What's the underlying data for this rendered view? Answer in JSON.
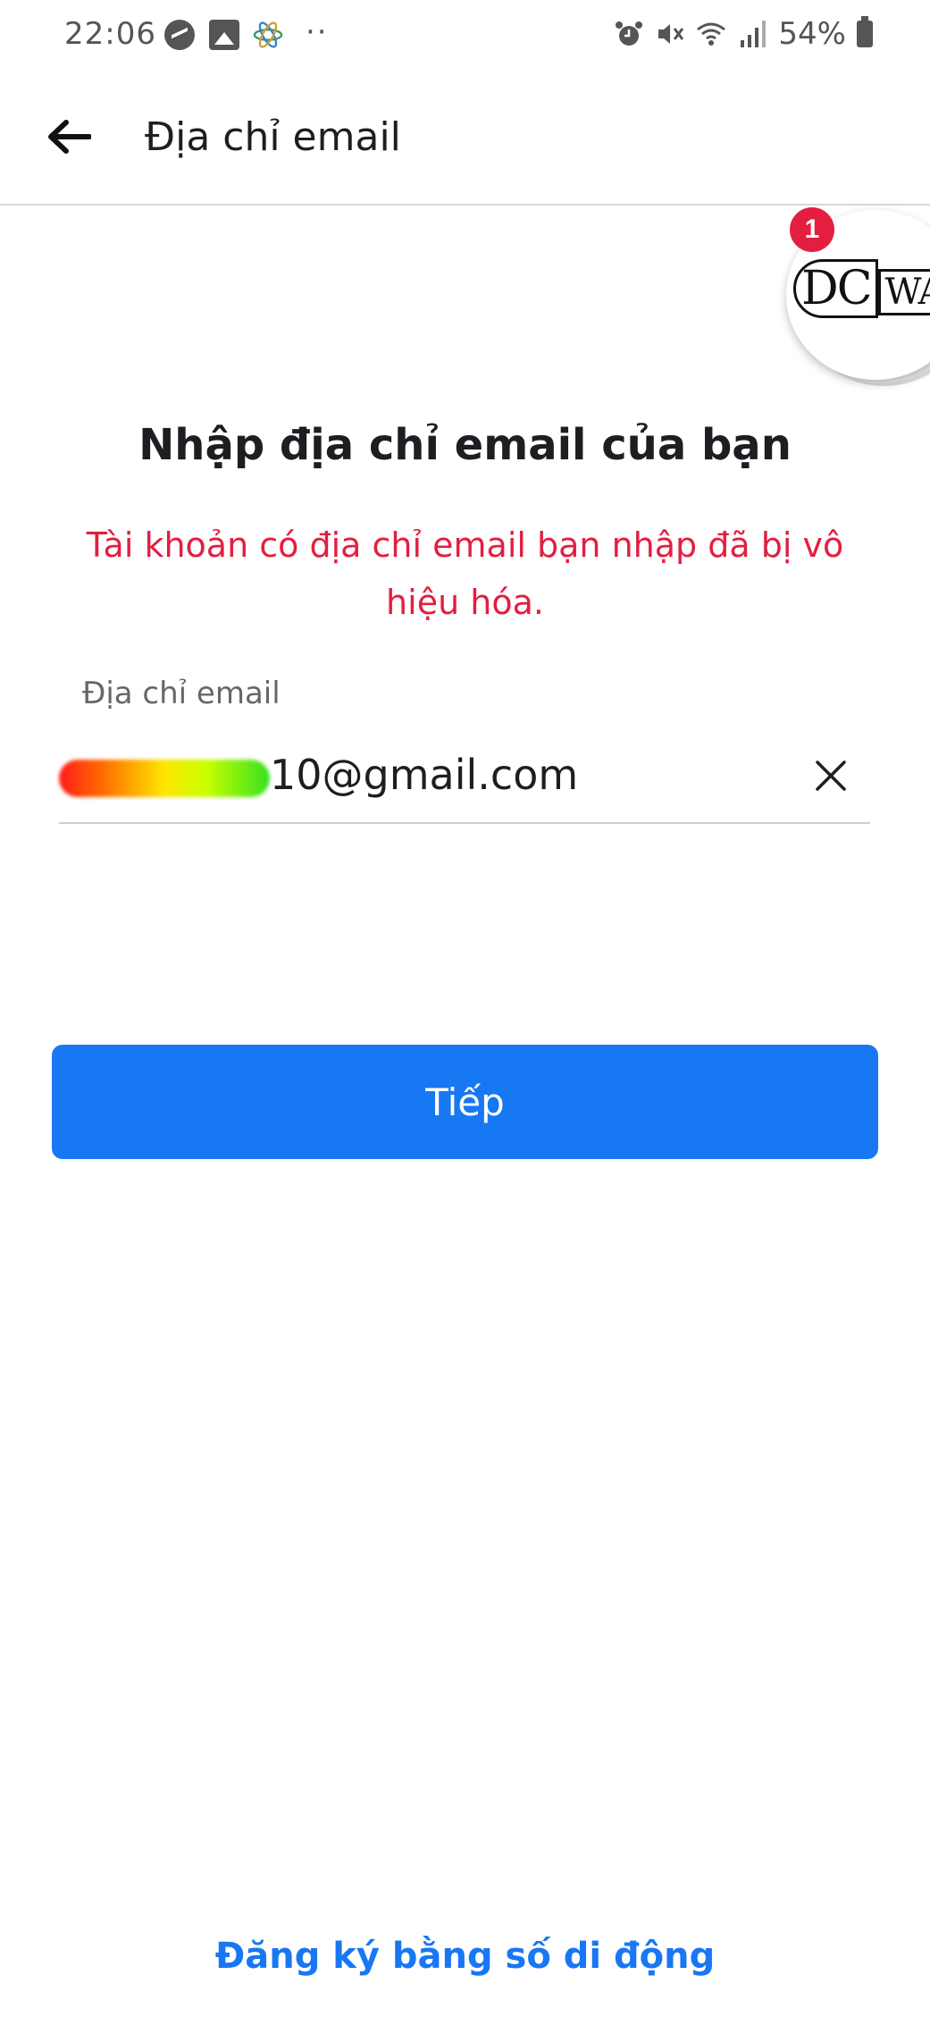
{
  "status_bar": {
    "time": "22:06",
    "dots": "··",
    "battery": "54%"
  },
  "header": {
    "title": "Địa chỉ email"
  },
  "floating_badge": {
    "count": "1",
    "logo_left": "DC",
    "logo_right": "WAO"
  },
  "main": {
    "heading": "Nhập địa chỉ email của bạn",
    "error": "Tài khoản có địa chỉ email bạn nhập đã bị vô hiệu hóa.",
    "email_label": "Địa chỉ email",
    "email_value": "10@gmail.com",
    "next_button": "Tiếp",
    "mobile_signup_link": "Đăng ký bằng số di động"
  },
  "colors": {
    "primary": "#1877f2",
    "error": "#e41e3f",
    "text": "#1c1e21",
    "muted": "#65676b"
  },
  "icons": {
    "back": "arrow-left-icon",
    "clear": "close-icon"
  }
}
